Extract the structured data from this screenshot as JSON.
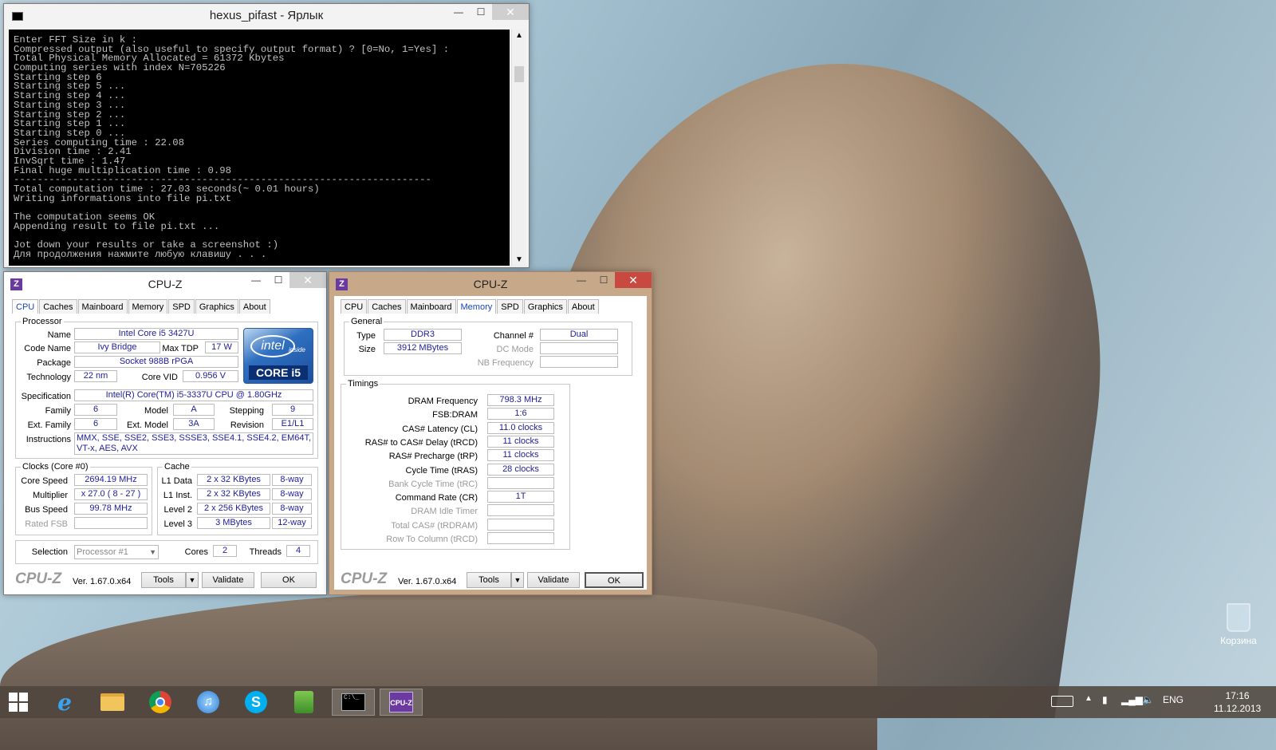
{
  "console": {
    "title": "hexus_pifast - Ярлык",
    "lines": [
      "Enter FFT Size in k :",
      "Compressed output (also useful to specify output format) ? [0=No, 1=Yes] :",
      "Total Physical Memory Allocated = 61372 Kbytes",
      "Computing series with index N=705226",
      "Starting step 6",
      "Starting step 5 ...",
      "Starting step 4 ...",
      "Starting step 3 ...",
      "Starting step 2 ...",
      "Starting step 1 ...",
      "Starting step 0 ...",
      "Series computing time : 22.08",
      "Division time : 2.41",
      "InvSqrt time : 1.47",
      "Final huge multiplication time : 0.98",
      "-----------------------------------------------------------------------",
      "Total computation time : 27.03 seconds(~ 0.01 hours)",
      "Writing informations into file pi.txt",
      "",
      "The computation seems OK",
      "Appending result to file pi.txt ...",
      "",
      "Jot down your results or take a screenshot :)",
      "Для продолжения нажмите любую клавишу . . ."
    ]
  },
  "cpuz1": {
    "title": "CPU-Z",
    "icon": "Z",
    "tabs": [
      "CPU",
      "Caches",
      "Mainboard",
      "Memory",
      "SPD",
      "Graphics",
      "About"
    ],
    "processor": {
      "legend": "Processor",
      "name_l": "Name",
      "name": "Intel Core i5 3427U",
      "code_l": "Code Name",
      "code": "Ivy Bridge",
      "tdp_l": "Max TDP",
      "tdp": "17 W",
      "pkg_l": "Package",
      "pkg": "Socket 988B rPGA",
      "tech_l": "Technology",
      "tech": "22 nm",
      "vid_l": "Core VID",
      "vid": "0.956 V",
      "spec_l": "Specification",
      "spec": "Intel(R) Core(TM) i5-3337U CPU @ 1.80GHz",
      "fam_l": "Family",
      "fam": "6",
      "model_l": "Model",
      "model": "A",
      "step_l": "Stepping",
      "step": "9",
      "efam_l": "Ext. Family",
      "efam": "6",
      "emodel_l": "Ext. Model",
      "emodel": "3A",
      "rev_l": "Revision",
      "rev": "E1/L1",
      "instr_l": "Instructions",
      "instr1": "MMX, SSE, SSE2, SSE3, SSSE3, SSE4.1, SSE4.2, EM64T,",
      "instr2": "VT-x, AES, AVX"
    },
    "intel": {
      "logo": "intel",
      "inside": "inside",
      "core": "CORE i5"
    },
    "clocks": {
      "legend": "Clocks (Core #0)",
      "cs_l": "Core Speed",
      "cs": "2694.19 MHz",
      "mult_l": "Multiplier",
      "mult": "x 27.0 ( 8 - 27 )",
      "bus_l": "Bus Speed",
      "bus": "99.78 MHz",
      "fsb_l": "Rated FSB",
      "fsb": ""
    },
    "cache": {
      "legend": "Cache",
      "l1d_l": "L1 Data",
      "l1d": "2 x 32 KBytes",
      "l1d_w": "8-way",
      "l1i_l": "L1 Inst.",
      "l1i": "2 x 32 KBytes",
      "l1i_w": "8-way",
      "l2_l": "Level 2",
      "l2": "2 x 256 KBytes",
      "l2_w": "8-way",
      "l3_l": "Level 3",
      "l3": "3 MBytes",
      "l3_w": "12-way"
    },
    "sel": {
      "sel_l": "Selection",
      "sel": "Processor #1",
      "cores_l": "Cores",
      "cores": "2",
      "threads_l": "Threads",
      "threads": "4"
    },
    "footer": {
      "logo": "CPU-Z",
      "ver": "Ver. 1.67.0.x64",
      "tools": "Tools",
      "validate": "Validate",
      "ok": "OK"
    }
  },
  "cpuz2": {
    "title": "CPU-Z",
    "icon": "Z",
    "tabs": [
      "CPU",
      "Caches",
      "Mainboard",
      "Memory",
      "SPD",
      "Graphics",
      "About"
    ],
    "general": {
      "legend": "General",
      "type_l": "Type",
      "type": "DDR3",
      "size_l": "Size",
      "size": "3912 MBytes",
      "chan_l": "Channel #",
      "chan": "Dual",
      "dc_l": "DC Mode",
      "dc": "",
      "nb_l": "NB Frequency",
      "nb": ""
    },
    "timings": {
      "legend": "Timings",
      "items": [
        {
          "l": "DRAM Frequency",
          "v": "798.3 MHz",
          "dim": false
        },
        {
          "l": "FSB:DRAM",
          "v": "1:6",
          "dim": false
        },
        {
          "l": "CAS# Latency (CL)",
          "v": "11.0 clocks",
          "dim": false
        },
        {
          "l": "RAS# to CAS# Delay (tRCD)",
          "v": "11 clocks",
          "dim": false
        },
        {
          "l": "RAS# Precharge (tRP)",
          "v": "11 clocks",
          "dim": false
        },
        {
          "l": "Cycle Time (tRAS)",
          "v": "28 clocks",
          "dim": false
        },
        {
          "l": "Bank Cycle Time (tRC)",
          "v": "",
          "dim": true
        },
        {
          "l": "Command Rate (CR)",
          "v": "1T",
          "dim": false
        },
        {
          "l": "DRAM Idle Timer",
          "v": "",
          "dim": true
        },
        {
          "l": "Total CAS# (tRDRAM)",
          "v": "",
          "dim": true
        },
        {
          "l": "Row To Column (tRCD)",
          "v": "",
          "dim": true
        }
      ]
    },
    "footer": {
      "logo": "CPU-Z",
      "ver": "Ver. 1.67.0.x64",
      "tools": "Tools",
      "validate": "Validate",
      "ok": "OK"
    }
  },
  "desktop": {
    "recycle_bin": "Корзина"
  },
  "taskbar": {
    "lang": "ENG",
    "time": "17:16",
    "date": "11.12.2013",
    "cpuz_label": "CPU-Z",
    "cmd_label": "C:\\_"
  }
}
